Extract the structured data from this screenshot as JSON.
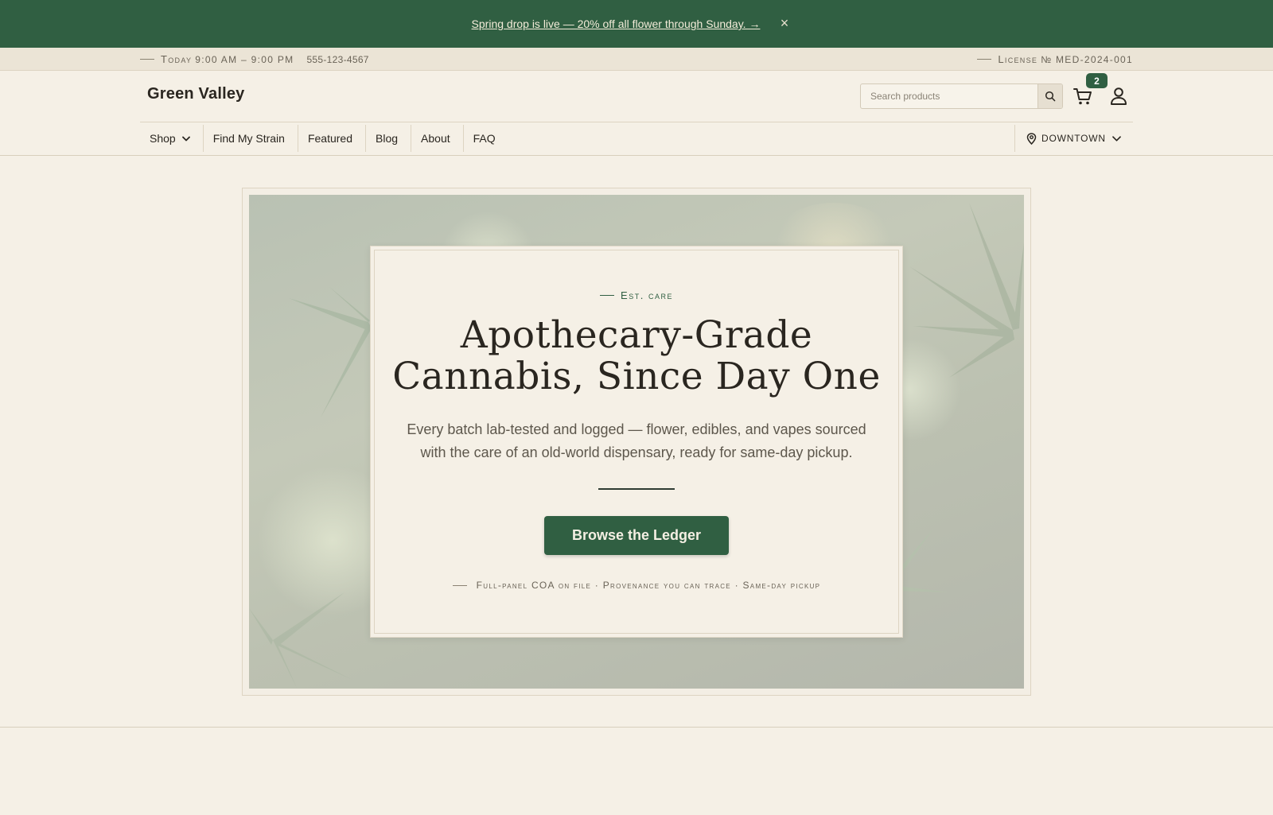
{
  "promo": {
    "text": "Spring drop is live — 20% off all flower through Sunday. →",
    "close": "×"
  },
  "info_bar": {
    "hours_label": "Today",
    "hours": "9:00 AM – 9:00 PM",
    "phone": "555-123-4567",
    "license_label": "License",
    "license": "№ MED-2024-001"
  },
  "header": {
    "brand": "Green Valley",
    "search_placeholder": "Search products",
    "cart_count": "2"
  },
  "nav": {
    "items": [
      {
        "label": "Shop",
        "has_dropdown": true
      },
      {
        "label": "Find My Strain"
      },
      {
        "label": "Featured"
      },
      {
        "label": "Blog"
      },
      {
        "label": "About"
      },
      {
        "label": "FAQ"
      }
    ],
    "store": "DOWNTOWN"
  },
  "hero": {
    "eyebrow": "Est. care",
    "headline_line1": "Apothecary-Grade",
    "headline_line2": "Cannabis, Since Day One",
    "subtext_line1": "Every batch lab-tested and logged — flower, edibles, and vapes sourced",
    "subtext_line2": "with the care of an old-world dispensary, ready for same-day pickup.",
    "cta": "Browse the Ledger",
    "trust": "Full-panel COA on file · Provenance you can trace · Same-day pickup"
  },
  "colors": {
    "brand_green": "#305f42",
    "background": "#f5f0e6",
    "info_bar": "#ebe4d6",
    "text": "#2a2620"
  }
}
